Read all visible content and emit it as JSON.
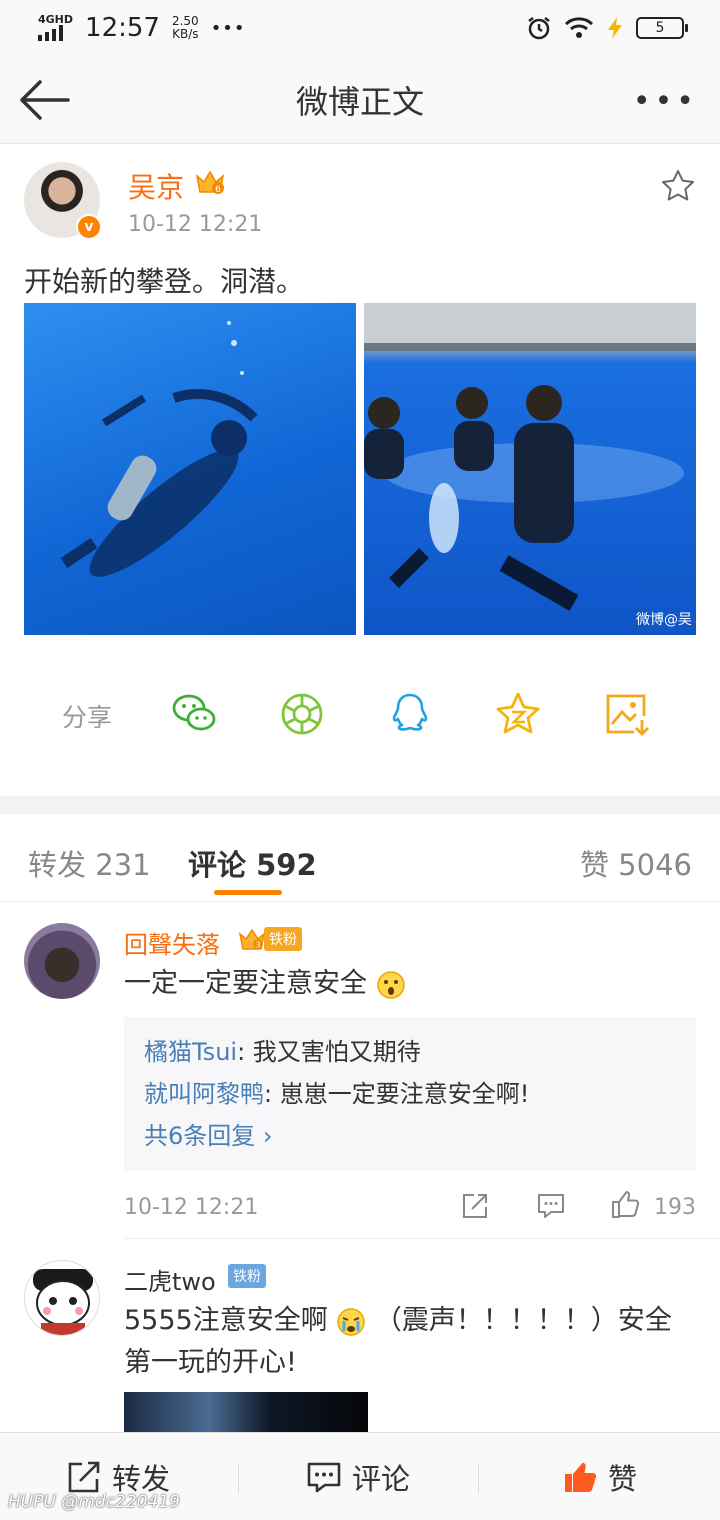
{
  "status_bar": {
    "network": "4GHD",
    "time": "12:57",
    "speed_value": "2.50",
    "speed_unit": "KB/s",
    "more": "•••",
    "battery": "5"
  },
  "nav": {
    "title": "微博正文",
    "more": "•••"
  },
  "post": {
    "author": "吴京",
    "verified": "v",
    "time": "10-12 12:21",
    "text": "开始新的攀登。洞潜。",
    "watermark": "微博@吴",
    "share_label": "分享"
  },
  "tabs": {
    "repost": "转发 231",
    "comment": "评论 592",
    "like": "赞 5046"
  },
  "comments": [
    {
      "name": "回聲失落",
      "badge": "铁粉",
      "text": "一定一定要注意安全",
      "replies": [
        {
          "name": "橘猫Tsui",
          "text": ": 我又害怕又期待"
        },
        {
          "name": "就叫阿黎鸭",
          "text": ": 崽崽一定要注意安全啊!"
        }
      ],
      "more_replies": "共6条回复 ›",
      "time": "10-12 12:21",
      "likes": "193"
    },
    {
      "name": "二虎two",
      "badge": "铁粉",
      "text": "5555注意安全啊",
      "text_cont": "（震声！！！！！）安全第一玩的开心!"
    }
  ],
  "bottom_bar": {
    "repost": "转发",
    "comment": "评论",
    "like": "赞"
  },
  "overlay": {
    "hupu": "HUPU @mdc220419"
  },
  "colors": {
    "brand_orange": "#ff8200",
    "link_blue": "#4a7fb5",
    "author_orange": "#f86e15"
  }
}
